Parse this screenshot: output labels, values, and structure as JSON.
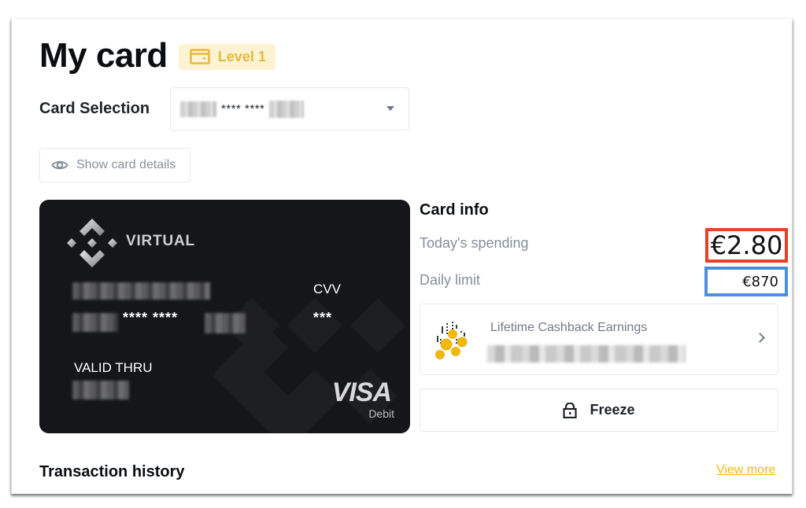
{
  "header": {
    "title": "My card",
    "level_badge": {
      "label": "Level 1",
      "icon": "card-icon",
      "color": "#e8b63a",
      "bg": "#fdf3d3"
    }
  },
  "card_selection": {
    "label": "Card Selection",
    "selected_value_masked": "**** ****",
    "icon": "caret-down-icon"
  },
  "show_details": {
    "label": "Show card details",
    "icon": "eye-icon"
  },
  "card": {
    "type_label": "VIRTUAL",
    "logo_icon": "binance-logo-icon",
    "number_masked": "**** ****",
    "cvv_label": "CVV",
    "cvv_value": "***",
    "valid_thru_label": "VALID THRU",
    "network": "VISA",
    "network_sub": "Debit"
  },
  "card_info": {
    "title": "Card info",
    "todays_spending": {
      "label": "Today's spending",
      "value": "€2.80",
      "highlight_color": "#e54127"
    },
    "daily_limit": {
      "label": "Daily limit",
      "value": "€870",
      "highlight_color": "#4a8fdd"
    }
  },
  "cashback": {
    "title": "Lifetime Cashback Earnings",
    "icon": "coins-icon",
    "chevron": "chevron-right-icon"
  },
  "freeze": {
    "label": "Freeze",
    "icon": "lock-icon"
  },
  "transactions": {
    "title": "Transaction history",
    "view_more": "View more",
    "link_color": "#f0b90b"
  }
}
